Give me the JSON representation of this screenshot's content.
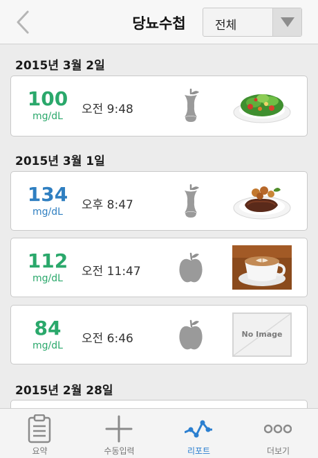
{
  "header": {
    "title": "당뇨수첩",
    "filter_value": "전체"
  },
  "groups": [
    {
      "date": "2015년 3월 2일"
    },
    {
      "date": "2015년 3월 1일"
    },
    {
      "date": "2015년 2월 28일"
    }
  ],
  "entries": [
    {
      "value": "100",
      "unit": "mg/dL",
      "time": "오전 9:48",
      "value_color": "#2aa86b",
      "meal_icon": "apple-core-icon",
      "photo": "salad-photo"
    },
    {
      "value": "134",
      "unit": "mg/dL",
      "time": "오후 8:47",
      "value_color": "#2f7fc1",
      "meal_icon": "apple-core-icon",
      "photo": "steak-photo"
    },
    {
      "value": "112",
      "unit": "mg/dL",
      "time": "오전 11:47",
      "value_color": "#2aa86b",
      "meal_icon": "apple-icon",
      "photo": "coffee-photo"
    },
    {
      "value": "84",
      "unit": "mg/dL",
      "time": "오전 6:46",
      "value_color": "#2aa86b",
      "meal_icon": "apple-icon",
      "photo": "placeholder",
      "placeholder_text": "No Image"
    }
  ],
  "tabs": [
    {
      "label": "요약",
      "icon": "clipboard-icon"
    },
    {
      "label": "수동입력",
      "icon": "plus-icon"
    },
    {
      "label": "리포트",
      "icon": "pulse-chart-icon",
      "active": true
    },
    {
      "label": "더보기",
      "icon": "more-dots-icon"
    }
  ],
  "colors": {
    "accent": "#2b7fd0",
    "normal": "#2aa86b",
    "high": "#2f7fc1"
  }
}
